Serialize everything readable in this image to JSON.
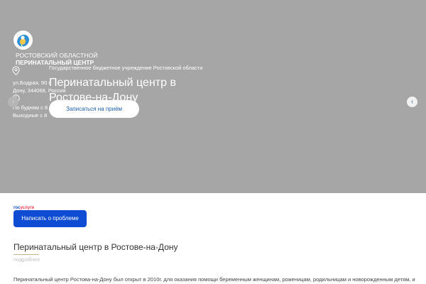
{
  "header": {
    "org_name_line1": "РОСТОВСКИЙ ОБЛАСТНОЙ",
    "org_name_line2": "ПЕРИНАТАЛЬНЫЙ ЦЕНТР"
  },
  "hero": {
    "subtitle": "Государственное бюджетное учреждение Ростовской области",
    "title": "Перинатальный центр в Ростове-на-Дону",
    "cta_label": "Записаться на приём"
  },
  "contacts": {
    "address_line1": "ул.Бодрая, 90 г.",
    "address_line2": "Дону, 344068, Россия",
    "hours_line1": "По будням с 8",
    "hours_line2": "Выходные с 8"
  },
  "gosuslugi": {
    "label_part1": "гос",
    "label_part2": "услуги",
    "button_label": "Написать о проблеме"
  },
  "section": {
    "title": "Перинатальный центр в Ростове-на-Дону",
    "more_link": "подробнее",
    "text": "Перинатальный центр Ростова-на-Дону был открыт в 2010г. для оказания помощи беременным женщинам, роженицам, родильницам и новорожденным детям, и"
  },
  "colors": {
    "hero_background": "#a6a6a6",
    "gosuslugi_blue": "#0d4cd3",
    "cta_text": "#1f5fa8"
  },
  "icons": [
    "logo-icon",
    "map-pin-icon",
    "clock-icon",
    "chevron-left-icon",
    "chevron-right-icon"
  ]
}
